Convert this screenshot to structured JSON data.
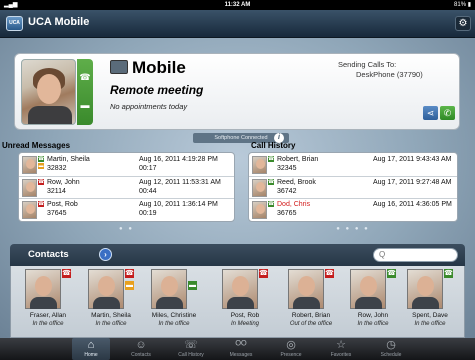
{
  "statusbar": {
    "time": "11:32 AM",
    "battery": "81%",
    "signal": "▂▄▆"
  },
  "app": {
    "title": "UCA Mobile",
    "logo": "UCA"
  },
  "profile": {
    "mode": "Mobile",
    "status": "Remote meeting",
    "appointments": "No appointments today",
    "sending_label": "Sending Calls To:",
    "sending_value": "DeskPhone (37790)"
  },
  "softphone": {
    "label": "Softphone Connected",
    "info": "i"
  },
  "unread": {
    "header": "Unread Messages",
    "rows": [
      {
        "name": "Martin, Sheila",
        "number": "32832",
        "date": "Aug 16, 2011  4:19:28 PM",
        "duration": "00:17"
      },
      {
        "name": "Row, John",
        "number": "32114",
        "date": "Aug 12, 2011  11:53:31 AM",
        "duration": "00:44"
      },
      {
        "name": "Post, Rob",
        "number": "37645",
        "date": "Aug 10, 2011  1:36:14 PM",
        "duration": "00:19"
      }
    ],
    "pager": "● ●"
  },
  "history": {
    "header": "Call History",
    "rows": [
      {
        "name": "Robert, Brian",
        "number": "32345",
        "date": "Aug 17, 2011  9:43:43 AM",
        "missed": false
      },
      {
        "name": "Reed, Brook",
        "number": "36742",
        "date": "Aug 17, 2011  9:27:48 AM",
        "missed": false
      },
      {
        "name": "Dod, Chris",
        "number": "36765",
        "date": "Aug 16, 2011  4:36:05 PM",
        "missed": true
      }
    ],
    "pager": "● ● ● ●"
  },
  "contacts": {
    "header": "Contacts",
    "search_placeholder": "Q",
    "items": [
      {
        "name": "Fraser, Allan",
        "status": "In the office"
      },
      {
        "name": "Martin, Sheila",
        "status": "In the office"
      },
      {
        "name": "Miles, Christine",
        "status": "In the office"
      },
      {
        "name": "Post, Rob",
        "status": "In Meeting"
      },
      {
        "name": "Robert, Brian",
        "status": "Out of the office"
      },
      {
        "name": "Row, John",
        "status": "In the office"
      },
      {
        "name": "Spent, Dave",
        "status": "In the office"
      }
    ]
  },
  "tabs": [
    {
      "label": "Home",
      "icon": "home-icon"
    },
    {
      "label": "Contacts",
      "icon": "person-icon"
    },
    {
      "label": "Call History",
      "icon": "call-history-icon"
    },
    {
      "label": "Messages",
      "icon": "voicemail-icon"
    },
    {
      "label": "Presence",
      "icon": "presence-icon"
    },
    {
      "label": "Favorites",
      "icon": "star-icon"
    },
    {
      "label": "Schedule",
      "icon": "clock-icon"
    }
  ],
  "colors": {
    "accent": "#3a8a2c",
    "missed": "#d21a1a",
    "titlebar": "#1f3346"
  }
}
